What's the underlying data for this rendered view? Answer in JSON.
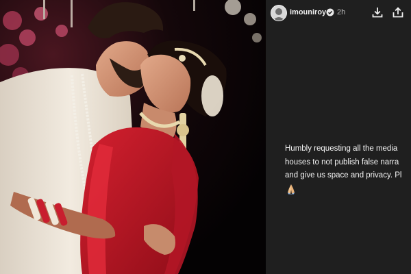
{
  "story": {
    "username": "imouniroy",
    "time": "2h",
    "caption_lines": [
      "Humbly requesting all the media",
      "houses to not publish false narra",
      "and give us space and privacy. Pl"
    ]
  },
  "icons": {
    "verified": "verified-badge-icon",
    "download": "download-icon",
    "share": "share-icon",
    "folded_hands": "folded-hands-emoji"
  },
  "colors": {
    "panel_bg": "#1f1f1f",
    "photo_bg": "#120608",
    "bride_outfit": "#c8182a",
    "groom_outfit": "#efe6d8",
    "verified_blue": "#3897f0"
  }
}
